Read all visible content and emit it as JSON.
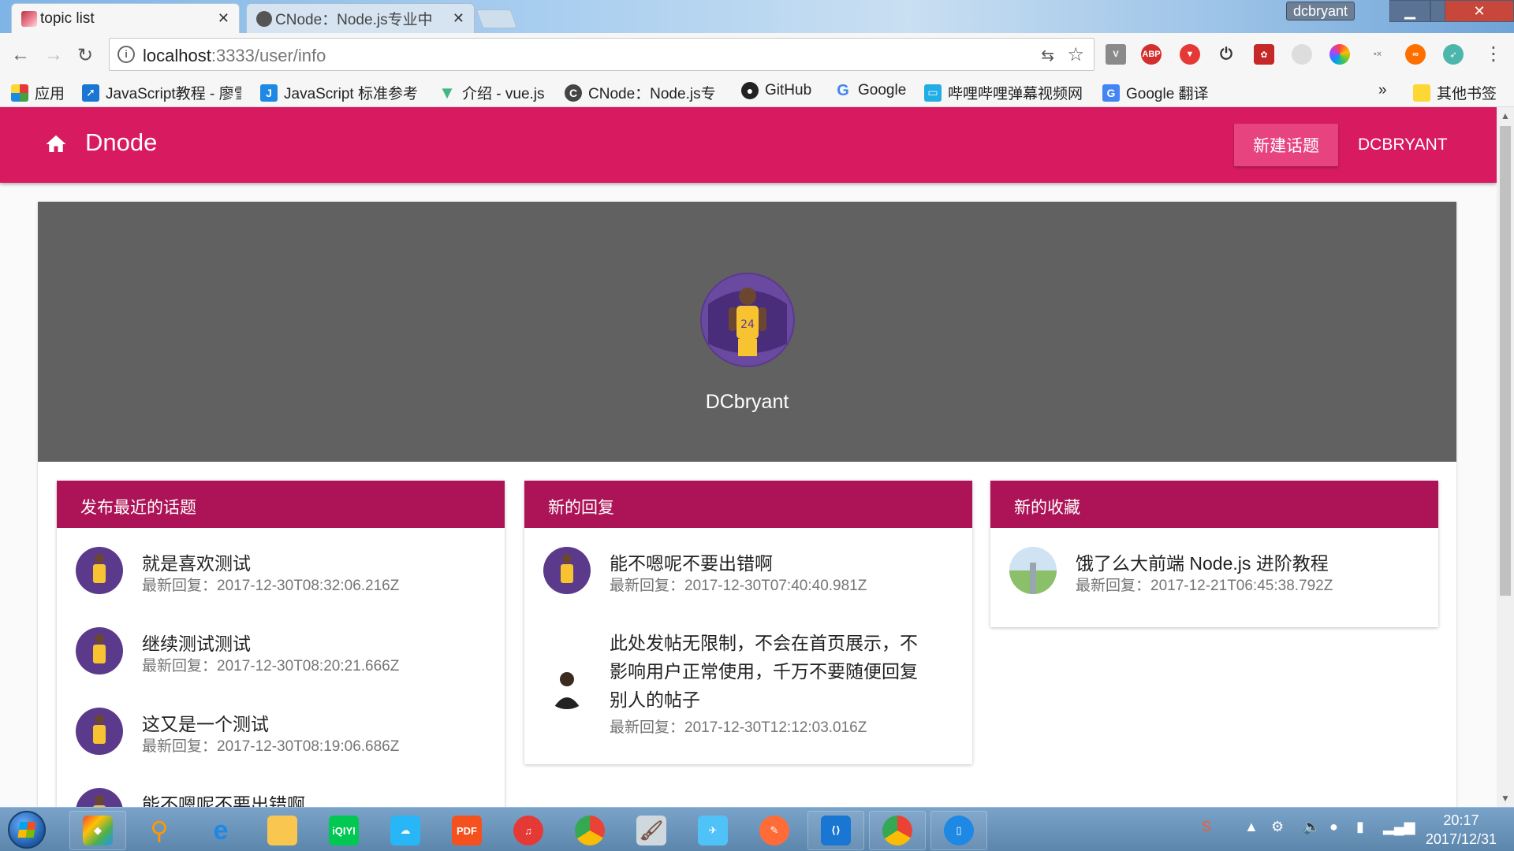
{
  "browser": {
    "tabs": [
      {
        "title": "topic list",
        "active": true
      },
      {
        "title": "CNode：Node.js专业中",
        "active": false
      }
    ],
    "window_user": "dcbryant",
    "url_host": "localhost",
    "url_rest": ":3333/user/info",
    "bookmarks": [
      "应用",
      "JavaScript教程 - 廖雪",
      "JavaScript 标准参考",
      "介绍 - vue.js",
      "CNode：Node.js专",
      "GitHub",
      "Google",
      "哔哩哔哩弹幕视频网",
      "Google 翻译"
    ],
    "bookmarks_overflow": "»",
    "other_bookmarks": "其他书签"
  },
  "app": {
    "brand": "Dnode",
    "new_topic_label": "新建话题",
    "username": "DCBRYANT",
    "accent_color": "#d81b60",
    "card_header_color": "#ad1457"
  },
  "profile": {
    "name": "DCbryant"
  },
  "cards": {
    "recent_topics": {
      "title": "发布最近的话题",
      "items": [
        {
          "title": "就是喜欢测试",
          "sub": "最新回复：2017-12-30T08:32:06.216Z"
        },
        {
          "title": "继续测试测试",
          "sub": "最新回复：2017-12-30T08:20:21.666Z"
        },
        {
          "title": "这又是一个测试",
          "sub": "最新回复：2017-12-30T08:19:06.686Z"
        },
        {
          "title": "能不嗯呢不要出错啊",
          "sub": ""
        }
      ]
    },
    "recent_replies": {
      "title": "新的回复",
      "items": [
        {
          "title": "能不嗯呢不要出错啊",
          "sub": "最新回复：2017-12-30T07:40:40.981Z"
        },
        {
          "title_lines": [
            "此处发帖无限制，不会在首页展示，不",
            "影响用户正常使用，千万不要随便回复",
            "别人的帖子"
          ],
          "sub": "最新回复：2017-12-30T12:12:03.016Z"
        }
      ]
    },
    "recent_collections": {
      "title": "新的收藏",
      "items": [
        {
          "title": "饿了么大前端 Node.js 进阶教程",
          "sub": "最新回复：2017-12-21T06:45:38.792Z"
        }
      ]
    }
  },
  "taskbar": {
    "time": "20:17",
    "date": "2017/12/31"
  }
}
